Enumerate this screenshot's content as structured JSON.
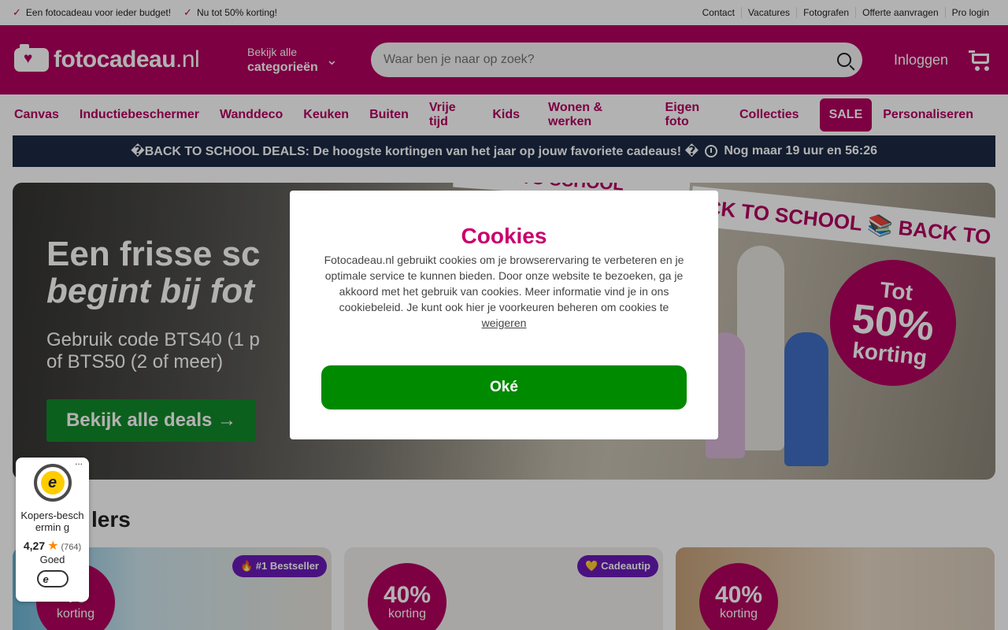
{
  "topbar": {
    "usps": [
      "Een fotocadeau voor ieder budget!",
      "Nu tot 50% korting!"
    ],
    "links": [
      "Contact",
      "Vacatures",
      "Fotografen",
      "Offerte aanvragen",
      "Pro login"
    ]
  },
  "header": {
    "logo_main": "fotocadeau",
    "logo_tld": ".nl",
    "categories_line1": "Bekijk alle",
    "categories_line2": "categorieën",
    "search_placeholder": "Waar ben je naar op zoek?",
    "login": "Inloggen"
  },
  "nav": [
    "Canvas",
    "Inductiebeschermer",
    "Wanddeco",
    "Keuken",
    "Buiten",
    "Vrije tijd",
    "Kids",
    "Wonen & werken",
    "Eigen foto",
    "Collecties",
    "SALE",
    "Personaliseren"
  ],
  "promo": {
    "text": "�BACK TO SCHOOL DEALS: De hoogste kortingen van het jaar op jouw favoriete cadeaus! �",
    "countdown": "Nog maar 19 uur en 56:26"
  },
  "hero": {
    "line1": "Een frisse sc",
    "line2": "begint bij fot",
    "code1": "Gebruik code BTS40 (1 p",
    "code2": "of BTS50 (2 of meer)",
    "cta": "Bekijk alle deals →",
    "ribbon": "CK TO SCHOOL 📚 BACK TO S",
    "ribbon_top": "BACK TO SCHOOL",
    "badge_top": "Tot",
    "badge_pct": "50%",
    "badge_bottom": "korting"
  },
  "bestsellers": {
    "title": "lers",
    "cards": [
      {
        "discount": "%",
        "label": "korting",
        "tag": "🔥 #1 Bestseller"
      },
      {
        "discount": "40%",
        "label": "korting",
        "tag": "💛 Cadeautip"
      },
      {
        "discount": "40%",
        "label": "korting",
        "tag": ""
      }
    ]
  },
  "trusted_shops": {
    "more": "...",
    "protection": "Kopers-beschermin g",
    "score": "4,27",
    "count": "(764)",
    "verdict": "Goed",
    "seal_letter": "e"
  },
  "cookie": {
    "title": "Cookies",
    "body": "Fotocadeau.nl gebruikt cookies om je browserervaring te verbeteren en je optimale service te kunnen bieden. Door onze website te bezoeken, ga je akkoord met het gebruik van cookies. Meer informatie vind je in ons cookiebeleid. Je kunt ook hier je voorkeuren beheren om cookies te",
    "refuse_link": "weigeren",
    "ok_button": "Oké"
  },
  "colors": {
    "brand": "#b4005f",
    "ok_green": "#008a00",
    "promo_bg": "#1c2a44"
  }
}
